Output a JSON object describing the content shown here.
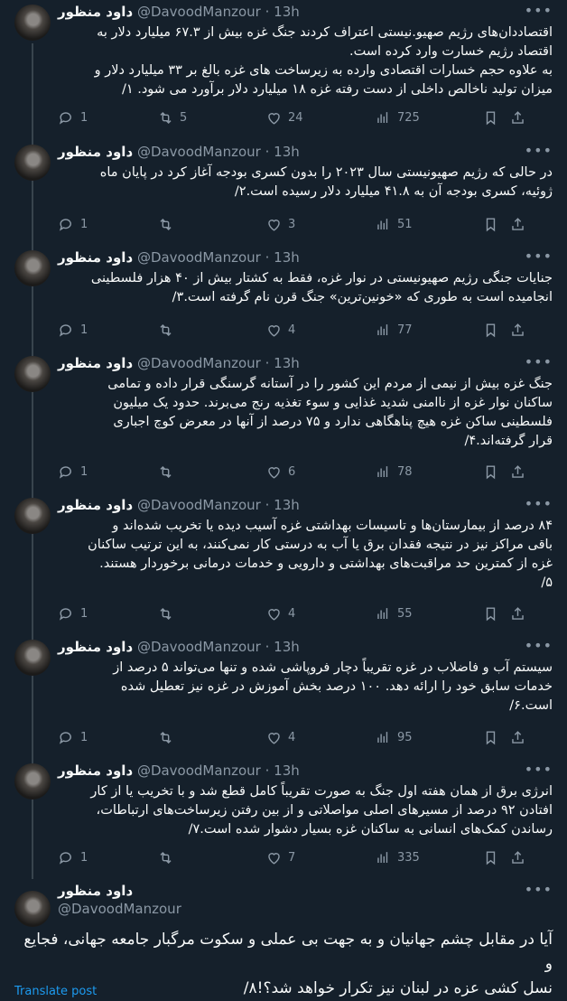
{
  "author": {
    "name": "داود منظور",
    "handle": "@DavoodManzour",
    "time": "13h",
    "dot": "·"
  },
  "more_glyph": "•••",
  "tweets": [
    {
      "text": "اقتصاددان‌های رژیم صهیو.نیستی اعتراف کردند جنگ غزه بیش از ۶۷.۳ میلیارد دلار به\nاقتصاد رژیم خسارت وارد کرده است.\nبه علاوه حجم خسارات اقتصادی وارده به زیرساخت های غزه بالغ بر ۳۳ میلیارد دلار و\nمیزان تولید ناخالص داخلی از  دست رفته غزه ۱۸ میلیارد دلار برآورد می شود. ۱/",
      "replies": "1",
      "retweets": "5",
      "likes": "24",
      "views": "725"
    },
    {
      "text": "در حالی که رژیم صهیونیستی سال ۲۰۲۳ را بدون کسری بودجه آغاز کرد در پایان ماه\nژوئیه، کسری بودجه آن به ۴۱.۸ میلیارد دلار رسیده است.۲/",
      "replies": "1",
      "retweets": "",
      "likes": "3",
      "views": "51"
    },
    {
      "text": "جنایات جنگی رژیم صهیونیستی در نوار غزه، فقط به کشتار بیش از ۴۰ هزار فلسطینی\nانجامیده است به طوری که «خونین‌ترین» جنگ قرن نام گرفته است.۳/",
      "replies": "1",
      "retweets": "",
      "likes": "4",
      "views": "77"
    },
    {
      "text": "جنگ غزه بیش از نیمی از مردم این کشور را در آستانه گرسنگی قرار داده و تمامی\nساکنان نوار غزه از ناامنی شدید غذایی و سوء تغذیه رنج می‌برند. حدود یک میلیون\nفلسطینی ساکن غزه هیچ پناهگاهی ندارد و ۷۵ درصد از آنها در معرض کوچ اجباری\nقرار گرفته‌اند.۴/",
      "replies": "1",
      "retweets": "",
      "likes": "6",
      "views": "78"
    },
    {
      "text": "۸۴ درصد از بیمارستان‌ها و تاسیسات بهداشتی غزه آسیب دیده یا تخریب شده‌اند و\nباقی مراکز نیز در نتیجه فقدان برق یا آب به درستی کار نمی‌کنند، به این ترتیب ساکنان\nغزه از کمترین حد مراقبت‌های بهداشتی و دارویی و خدمات درمانی برخوردار هستند.\n۵/",
      "replies": "1",
      "retweets": "",
      "likes": "4",
      "views": "55"
    },
    {
      "text": "سیستم آب و فاضلاب در غزه تقریباً دچار فروپاشی شده و تنها می‌تواند ۵ درصد از\nخدمات سابق خود را ارائه دهد. ۱۰۰ درصد بخش آموزش در غزه نیز تعطیل شده\nاست.۶/",
      "replies": "1",
      "retweets": "",
      "likes": "4",
      "views": "95"
    },
    {
      "text": "انرژی برق از همان هفته اول جنگ به صورت تقریباً کامل قطع شد و با تخریب یا از کار\nافتادن ۹۲ درصد از مسیرهای اصلی مواصلاتی و از بین رفتن زیرساخت‌های ارتباطات،\nرساندن کمک‌های انسانی به ساکنان غزه بسیار دشوار شده است.۷/",
      "replies": "1",
      "retweets": "",
      "likes": "7",
      "views": "335"
    }
  ],
  "last_tweet": {
    "text": "آیا در مقابل چشم جهانیان و به جهت بی عملی و سکوت مرگبار جامعه جهانی، فجایع و\nنسل کشی عزه در لبنان نیز تکرار خواهد شد؟!۸/",
    "translate_label": "Translate post"
  }
}
